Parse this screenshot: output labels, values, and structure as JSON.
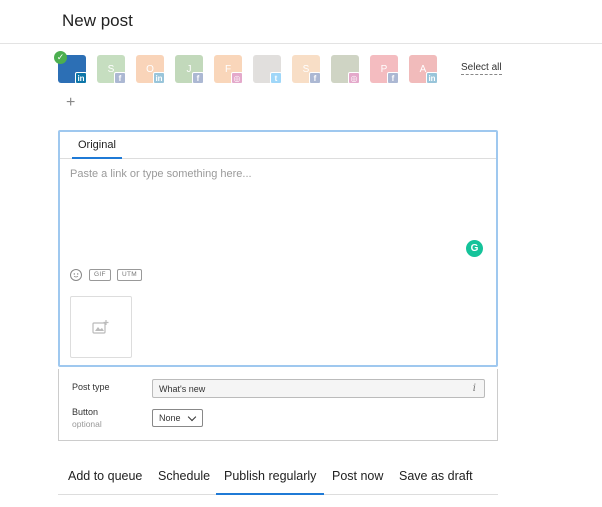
{
  "page": {
    "title": "New post"
  },
  "accounts": [
    {
      "initial": "",
      "network": "linkedin",
      "badge": "in",
      "color": "#2c6fb5",
      "selected": true
    },
    {
      "initial": "S",
      "network": "facebook",
      "badge": "f",
      "color": "#79b36a",
      "selected": false
    },
    {
      "initial": "O",
      "network": "linkedin",
      "badge": "in",
      "color": "#f19a5a",
      "selected": false
    },
    {
      "initial": "J",
      "network": "facebook",
      "badge": "f",
      "color": "#6fa55e",
      "selected": false
    },
    {
      "initial": "F",
      "network": "instagram",
      "badge": "◎",
      "color": "#f2a05c",
      "selected": false
    },
    {
      "initial": "",
      "network": "twitter",
      "badge": "t",
      "color": "#b9b4b0",
      "selected": false
    },
    {
      "initial": "S",
      "network": "facebook",
      "badge": "f",
      "color": "#f0b27a",
      "selected": false
    },
    {
      "initial": "",
      "network": "instagram",
      "badge": "◎",
      "color": "#8e9b74",
      "selected": false
    },
    {
      "initial": "P",
      "network": "facebook",
      "badge": "f",
      "color": "#e5616a",
      "selected": false
    },
    {
      "initial": "A",
      "network": "linkedin",
      "badge": "in",
      "color": "#e0605f",
      "selected": false
    }
  ],
  "select_all_label": "Select all",
  "add_account_symbol": "+",
  "composer": {
    "tab_label": "Original",
    "placeholder": "Paste a link or type something here...",
    "grammarly_glyph": "G",
    "gif_label": "GIF",
    "utm_label": "UTM"
  },
  "options": {
    "post_type_label": "Post type",
    "post_type_value": "What's new",
    "info_glyph": "i",
    "button_label": "Button",
    "button_sublabel": "optional",
    "button_value": "None"
  },
  "actions": {
    "add_to_queue": "Add to queue",
    "schedule": "Schedule",
    "publish_regularly": "Publish regularly",
    "post_now": "Post now",
    "save_as_draft": "Save as draft",
    "active": "publish_regularly"
  }
}
